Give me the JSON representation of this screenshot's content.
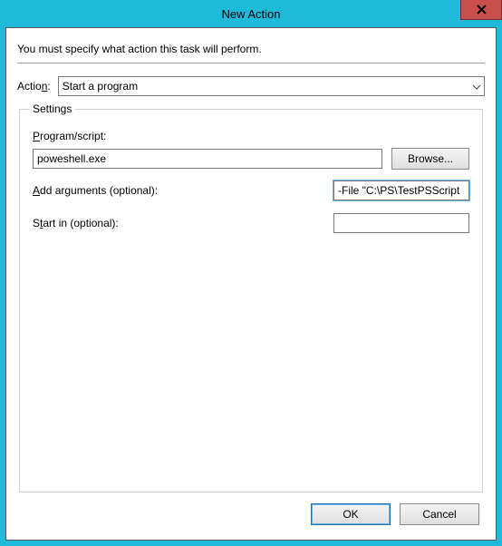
{
  "window": {
    "title": "New Action"
  },
  "instruction": "You must specify what action this task will perform.",
  "action": {
    "label_pre": "Actio",
    "label_u": "n",
    "label_post": ":",
    "selected": "Start a program"
  },
  "settings": {
    "legend": "Settings",
    "program": {
      "label_u": "P",
      "label_post": "rogram/script:",
      "value": "poweshell.exe",
      "browse": "Browse..."
    },
    "arguments": {
      "label_u": "A",
      "label_post": "dd arguments (optional):",
      "value": "-File \"C:\\PS\\TestPSScript"
    },
    "startin": {
      "label_pre": "S",
      "label_u": "t",
      "label_post": "art in (optional):",
      "value": ""
    }
  },
  "buttons": {
    "ok": "OK",
    "cancel": "Cancel"
  }
}
